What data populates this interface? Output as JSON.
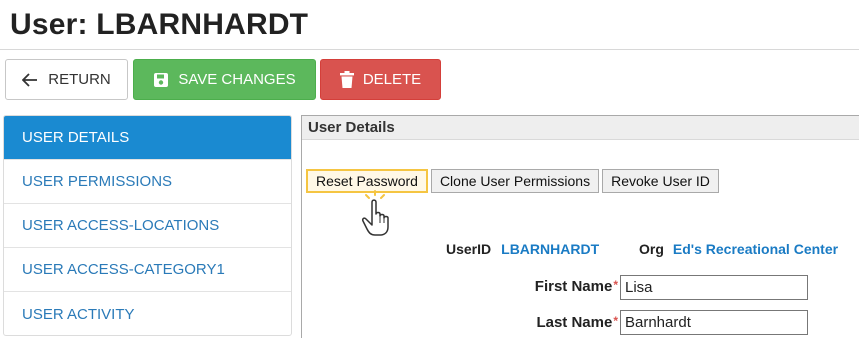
{
  "page": {
    "title": "User: LBARNHARDT"
  },
  "toolbar": {
    "return_label": "RETURN",
    "return_icon": "arrow-left-icon",
    "save_label": "SAVE CHANGES",
    "save_icon": "floppy-disk-icon",
    "delete_label": "DELETE",
    "delete_icon": "trash-icon",
    "colors": {
      "save": "#5cb85c",
      "delete": "#d9534f"
    }
  },
  "sidebar": {
    "items": [
      {
        "label": "USER DETAILS",
        "active": true
      },
      {
        "label": "USER PERMISSIONS",
        "active": false
      },
      {
        "label": "USER ACCESS-LOCATIONS",
        "active": false
      },
      {
        "label": "USER ACCESS-CATEGORY1",
        "active": false
      },
      {
        "label": "USER ACTIVITY",
        "active": false
      }
    ],
    "active_color": "#1a8ad1"
  },
  "panel": {
    "header": "User Details",
    "actions": {
      "reset_password": "Reset Password",
      "clone_permissions": "Clone User Permissions",
      "revoke_user_id": "Revoke User ID"
    },
    "info": {
      "userid_label": "UserID",
      "userid_value": "LBARNHARDT",
      "org_label": "Org",
      "org_value": "Ed's Recreational Center"
    },
    "fields": {
      "first_name_label": "First Name",
      "first_name_value": "Lisa",
      "last_name_label": "Last Name",
      "last_name_value": "Barnhardt",
      "required_mark": "*"
    }
  },
  "cursor": {
    "icon": "hand-pointer-icon"
  }
}
